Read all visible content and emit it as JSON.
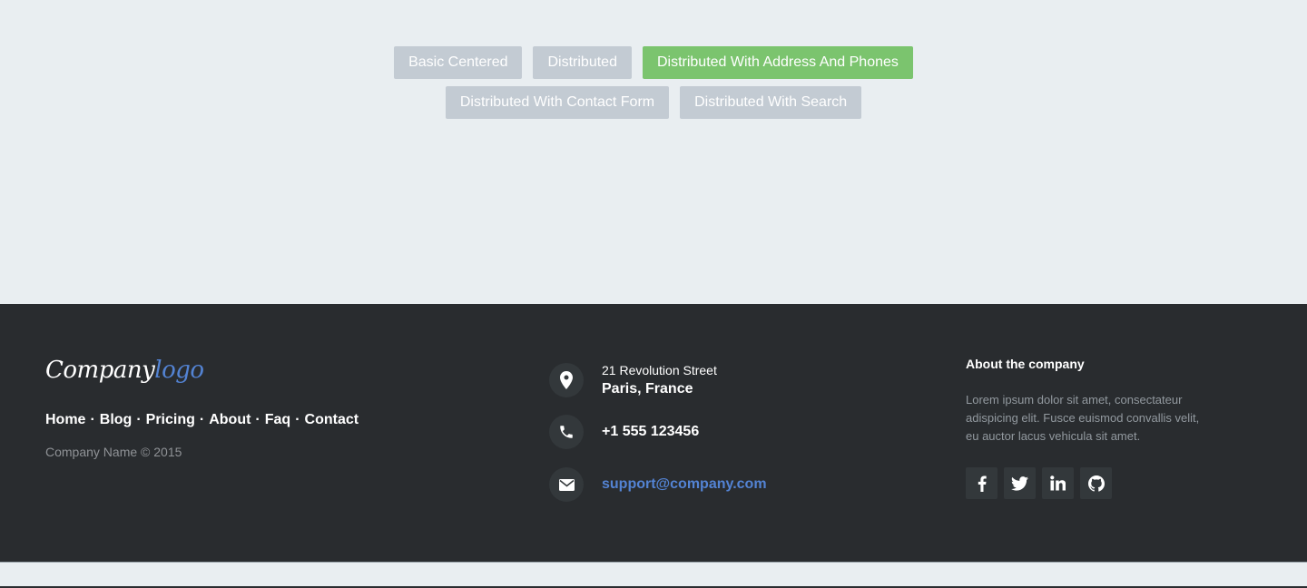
{
  "variants": {
    "row1": [
      "Basic Centered",
      "Distributed",
      "Distributed With Address And Phones"
    ],
    "row2": [
      "Distributed With Contact Form",
      "Distributed With Search"
    ],
    "active": "Distributed With Address And Phones",
    "colors": {
      "inactive": "#c3cbd3",
      "active": "#7bc46e"
    }
  },
  "footer": {
    "logo": {
      "main": "Company",
      "accent": "logo",
      "accent_color": "#5383d3"
    },
    "links": [
      "Home",
      "Blog",
      "Pricing",
      "About",
      "Faq",
      "Contact"
    ],
    "separator": "·",
    "copyright": "Company Name © 2015",
    "address": {
      "street": "21 Revolution Street",
      "city": "Paris, France",
      "icon": "map-marker-icon"
    },
    "phone": {
      "number": "+1 555 123456",
      "icon": "phone-icon"
    },
    "email": {
      "address": "support@company.com",
      "icon": "envelope-icon"
    },
    "about": {
      "title": "About the company",
      "text": "Lorem ipsum dolor sit amet, consectateur adispicing elit. Fusce euismod convallis velit, eu auctor lacus vehicula sit amet."
    },
    "socials": [
      "facebook-icon",
      "twitter-icon",
      "linkedin-icon",
      "github-icon"
    ],
    "background": "#292c2f"
  }
}
